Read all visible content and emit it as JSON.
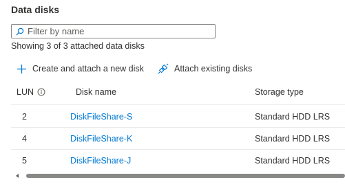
{
  "section": {
    "title": "Data disks"
  },
  "filter": {
    "placeholder": "Filter by name",
    "value": ""
  },
  "status": {
    "showing": "Showing 3 of 3 attached data disks"
  },
  "commands": {
    "create": {
      "label": "Create and attach a new disk",
      "icon": "plus-icon"
    },
    "attach": {
      "label": "Attach existing disks",
      "icon": "attach-link-icon"
    }
  },
  "table": {
    "headers": {
      "lun": "LUN",
      "name": "Disk name",
      "type": "Storage type"
    },
    "rows": [
      {
        "lun": "2",
        "name": "DiskFileShare-S",
        "type": "Standard HDD LRS"
      },
      {
        "lun": "4",
        "name": "DiskFileShare-K",
        "type": "Standard HDD LRS"
      },
      {
        "lun": "5",
        "name": "DiskFileShare-J",
        "type": "Standard HDD LRS"
      }
    ]
  },
  "colors": {
    "accent": "#0078d4",
    "text": "#323130",
    "divider": "#edebe9"
  }
}
